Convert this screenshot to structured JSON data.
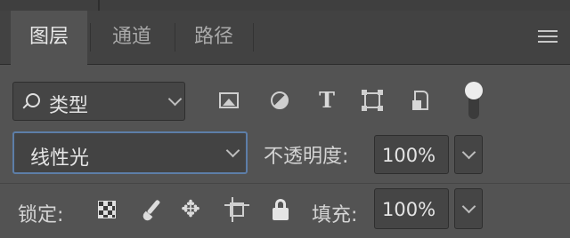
{
  "panel": {
    "tabs": [
      {
        "label": "图层",
        "active": true
      },
      {
        "label": "通道",
        "active": false
      },
      {
        "label": "路径",
        "active": false
      }
    ],
    "menu_icon": "hamburger-menu-icon"
  },
  "filter": {
    "kind_label": "类型",
    "icons": [
      "image-filter-icon",
      "adjustment-filter-icon",
      "type-filter-icon",
      "shape-filter-icon",
      "smart-object-filter-icon"
    ],
    "toggle": "filter-toggle"
  },
  "blend": {
    "mode": "线性光",
    "opacity_label": "不透明度:",
    "opacity_value": "100%"
  },
  "lock": {
    "label": "锁定:",
    "icons": [
      "lock-transparent-pixels-icon",
      "lock-image-pixels-icon",
      "lock-position-icon",
      "lock-artboard-icon",
      "lock-all-icon"
    ],
    "fill_label": "填充:",
    "fill_value": "100%"
  },
  "colors": {
    "panel_bg": "#535353",
    "tab_bar_bg": "#424242",
    "focus_border": "#5d7ea8"
  }
}
